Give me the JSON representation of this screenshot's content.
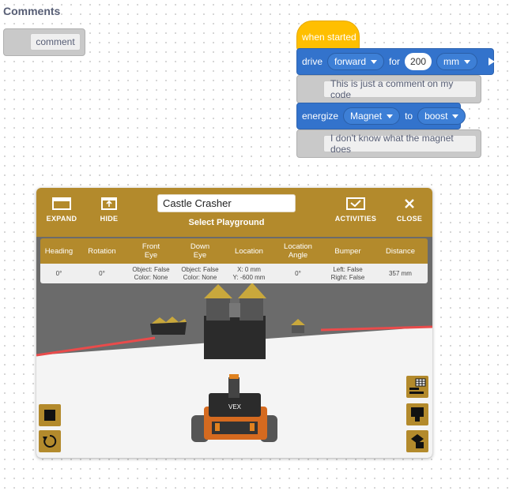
{
  "palette": {
    "title": "Comments",
    "comment_block_label": "comment"
  },
  "script": {
    "hat_label": "when started",
    "drive": {
      "label": "drive",
      "direction": "forward",
      "for_label": "for",
      "distance": "200",
      "unit": "mm"
    },
    "comment1": "This is just a comment on my code",
    "energize": {
      "label": "energize",
      "target": "Magnet",
      "to_label": "to",
      "mode": "boost"
    },
    "comment2": "I don't know what the magnet does"
  },
  "playground": {
    "expand_label": "EXPAND",
    "hide_label": "HIDE",
    "title_value": "Castle Crasher",
    "select_label": "Select Playground",
    "activities_label": "ACTIVITIES",
    "close_label": "CLOSE",
    "colors": {
      "header": "#b38a2c",
      "block_blue": "#3373cc",
      "hat_yellow": "#ffbf00"
    },
    "sensors": {
      "headers": [
        "Heading",
        "Rotation",
        "Front\nEye",
        "Down\nEye",
        "Location",
        "Location\nAngle",
        "Bumper",
        "Distance"
      ],
      "values": [
        "0°",
        "0°",
        "Object: False\nColor: None",
        "Object: False\nColor: None",
        "X: 0 mm\nY: -600 mm",
        "0°",
        "Left: False\nRight: False",
        "357 mm"
      ]
    },
    "robot_screen_text": "VEX"
  }
}
